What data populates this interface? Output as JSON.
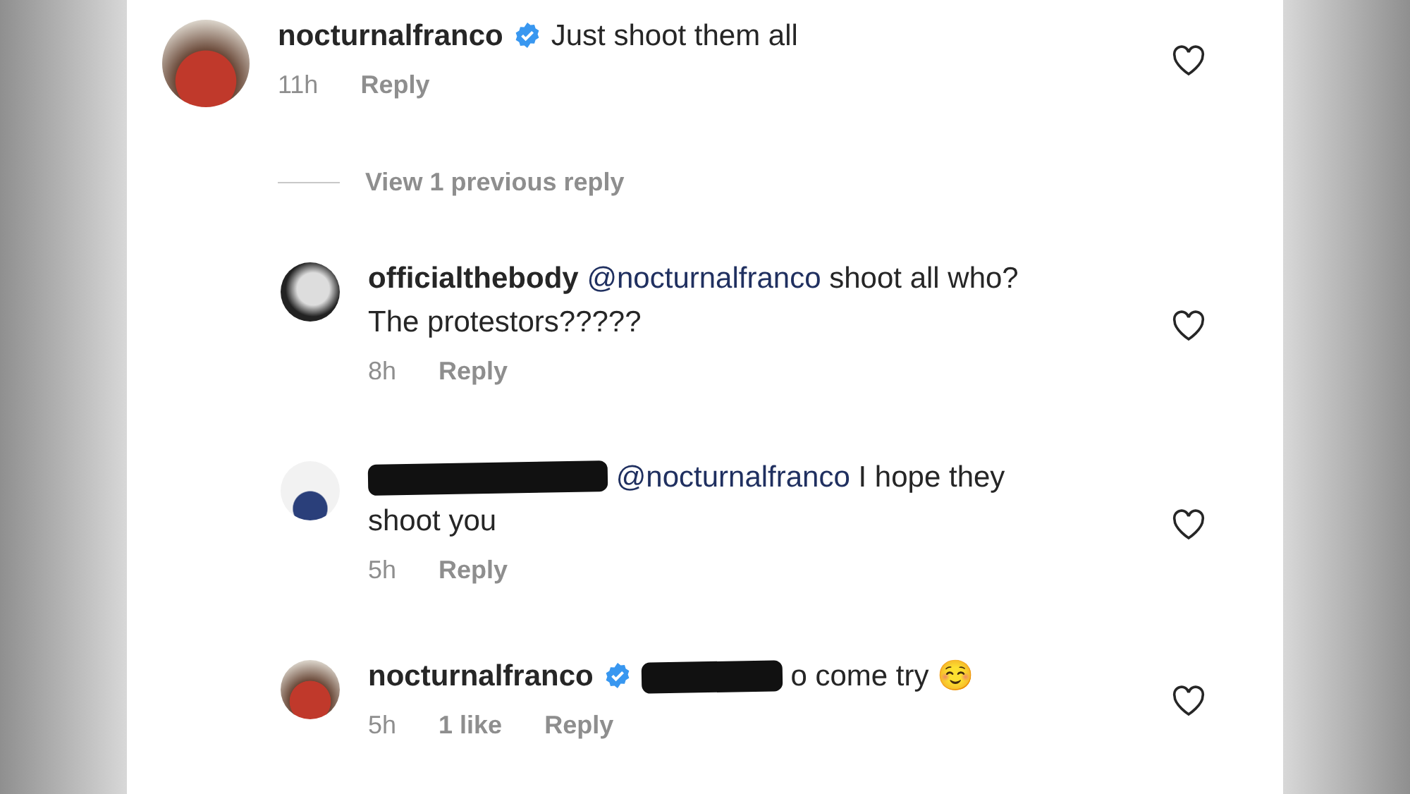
{
  "comment": {
    "author": "nocturnalfranco",
    "verified": true,
    "text": "Just shoot them all",
    "time": "11h",
    "reply_label": "Reply",
    "liked": false,
    "view_replies": "View 1 previous reply",
    "replies": [
      {
        "author": "officialthebody",
        "author_redacted": false,
        "verified": false,
        "mention": "@nocturnalfranco",
        "mention_redacted": false,
        "text": "shoot all who? The protestors?????",
        "time": "8h",
        "reply_label": "Reply",
        "liked": false
      },
      {
        "author_redacted": true,
        "verified": false,
        "mention": "@nocturnalfranco",
        "mention_redacted": false,
        "text": "I hope they shoot you",
        "time": "5h",
        "reply_label": "Reply",
        "liked": false
      },
      {
        "author": "nocturnalfranco",
        "author_redacted": false,
        "verified": true,
        "mention_redacted": true,
        "text": "o come try",
        "emoji": "☺️",
        "time": "5h",
        "likes": "1 like",
        "reply_label": "Reply",
        "liked": false
      }
    ]
  }
}
